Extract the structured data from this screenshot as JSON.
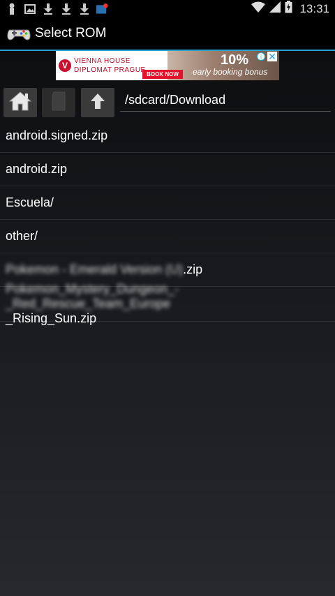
{
  "status_bar": {
    "time": "13:31",
    "left_icons": [
      "usb-icon",
      "image-icon",
      "download-icon",
      "download-icon",
      "download-icon",
      "notification-icon"
    ],
    "right_icons": [
      "wifi-icon",
      "signal-icon",
      "battery-icon"
    ]
  },
  "action_bar": {
    "title": "Select ROM",
    "accent_color": "#2aa3c8"
  },
  "ad": {
    "logo_letter": "V",
    "line1": "VIENNA HOUSE",
    "line2": "DIPLOMAT PRAGUE",
    "book_button": "BOOK NOW",
    "percent": "10%",
    "subtext": "early booking bonus",
    "info_icon": "info-icon",
    "close_icon": "close-icon"
  },
  "toolbar": {
    "home_icon": "home-icon",
    "disabled_icon": "sd-card-icon",
    "up_icon": "up-arrow-icon",
    "path": "/sdcard/Download"
  },
  "files": [
    {
      "name": "android.signed.zip"
    },
    {
      "name": "android.zip"
    },
    {
      "name": "Escuela/"
    },
    {
      "name": "other/"
    },
    {
      "name_hidden": "Pokemon - Emerald Version (U)",
      "name_suffix": ".zip"
    },
    {
      "name_line1": "Pokemon_Mystery_Dungeon_-_Red_Rescue_Team_Europe",
      "name_line2": "_Rising_Sun.zip"
    }
  ]
}
